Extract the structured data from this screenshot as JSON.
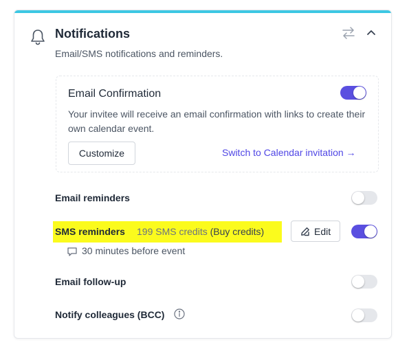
{
  "header": {
    "title": "Notifications",
    "subtitle": "Email/SMS notifications and reminders."
  },
  "email_confirmation": {
    "title": "Email Confirmation",
    "description": "Your invitee will receive an email confirmation with links to create their own calendar event.",
    "customize_label": "Customize",
    "switch_link": "Switch to Calendar invitation →",
    "enabled": true
  },
  "rows": {
    "email_reminders": {
      "label": "Email reminders",
      "enabled": false
    },
    "sms_reminders": {
      "label": "SMS reminders",
      "credits": "199 SMS credits",
      "buy": "(Buy credits)",
      "edit_label": "Edit",
      "detail": "30 minutes before event",
      "enabled": true
    },
    "email_followup": {
      "label": "Email follow-up",
      "enabled": false
    },
    "notify_colleagues": {
      "label": "Notify colleagues (BCC)",
      "enabled": false
    }
  },
  "colors": {
    "accent": "#5a4fe0",
    "top_bar": "#3cc7e3",
    "highlight": "#fbfb1d",
    "link": "#4f46e5"
  },
  "icons": [
    "bell-icon",
    "swap-arrows-icon",
    "chevron-up-icon",
    "edit-pencil-icon",
    "comment-icon",
    "info-icon"
  ]
}
